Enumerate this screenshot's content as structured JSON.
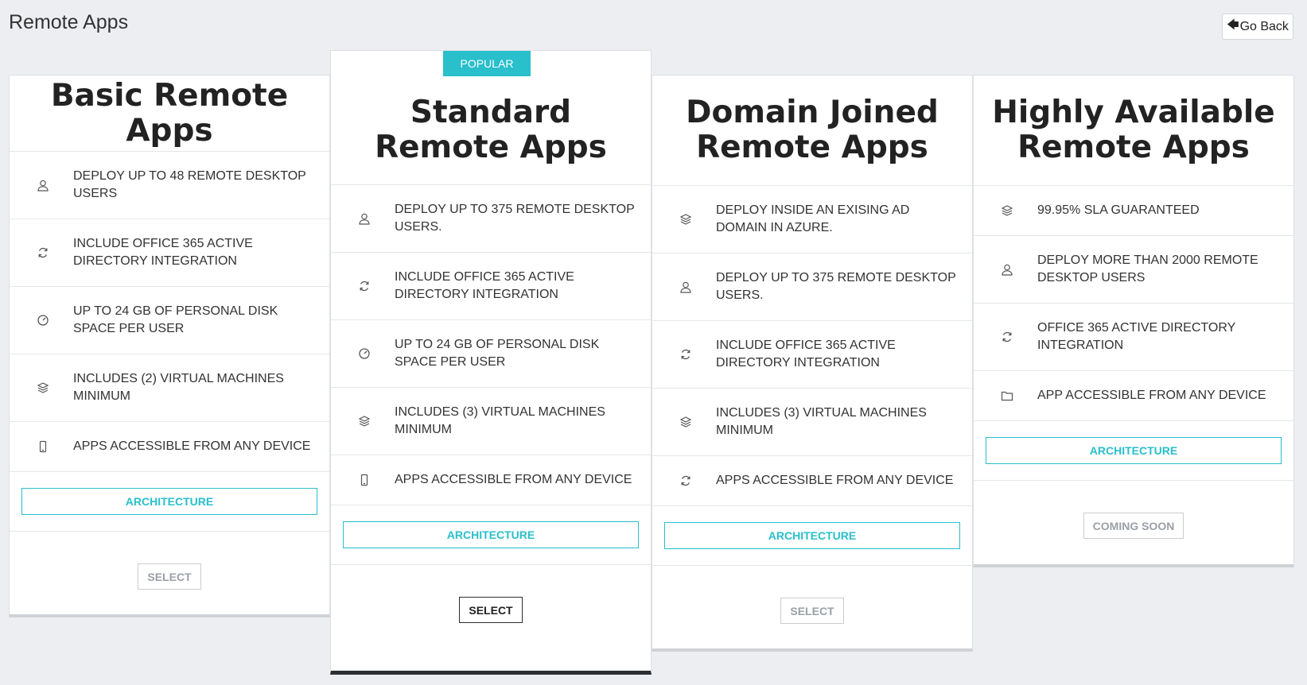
{
  "page": {
    "title": "Remote Apps",
    "go_back_label": "Go Back",
    "go_back_icon": "arrow-left-icon"
  },
  "colors": {
    "accent": "#29bfcb",
    "background": "#eceef2",
    "popular_badge": "#29bfcb",
    "standard_bottom_border": "#2b2f33"
  },
  "cards": [
    {
      "title": "Basic Remote Apps",
      "features": [
        {
          "icon": "user-icon",
          "text": "DEPLOY UP TO 48 REMOTE DESKTOP USERS"
        },
        {
          "icon": "sync-icon",
          "text": "INCLUDE OFFICE 365 ACTIVE DIRECTORY INTEGRATION"
        },
        {
          "icon": "gauge-icon",
          "text": "UP TO 24 GB OF PERSONAL DISK SPACE PER USER"
        },
        {
          "icon": "layers-icon",
          "text": "INCLUDES (2) VIRTUAL MACHINES MINIMUM"
        },
        {
          "icon": "mobile-icon",
          "text": "APPS ACCESSIBLE FROM ANY DEVICE"
        }
      ],
      "architecture_label": "ARCHITECTURE",
      "action_label": "SELECT"
    },
    {
      "badge": "POPULAR",
      "title": "Standard Remote Apps",
      "features": [
        {
          "icon": "user-icon",
          "text": "DEPLOY UP TO 375 REMOTE DESKTOP USERS."
        },
        {
          "icon": "sync-icon",
          "text": "INCLUDE OFFICE 365 ACTIVE DIRECTORY INTEGRATION"
        },
        {
          "icon": "gauge-icon",
          "text": "UP TO 24 GB OF PERSONAL DISK SPACE PER USER"
        },
        {
          "icon": "layers-icon",
          "text": "INCLUDES (3) VIRTUAL MACHINES MINIMUM"
        },
        {
          "icon": "mobile-icon",
          "text": "APPS ACCESSIBLE FROM ANY DEVICE"
        }
      ],
      "architecture_label": "ARCHITECTURE",
      "action_label": "SELECT"
    },
    {
      "title": "Domain Joined Remote Apps",
      "features": [
        {
          "icon": "layers-icon",
          "text": "DEPLOY INSIDE AN EXISING AD DOMAIN IN AZURE."
        },
        {
          "icon": "user-icon",
          "text": "DEPLOY UP TO 375 REMOTE DESKTOP USERS."
        },
        {
          "icon": "sync-icon",
          "text": "INCLUDE OFFICE 365 ACTIVE DIRECTORY INTEGRATION"
        },
        {
          "icon": "layers-icon",
          "text": "INCLUDES (3) VIRTUAL MACHINES MINIMUM"
        },
        {
          "icon": "sync-icon",
          "text": "APPS ACCESSIBLE FROM ANY DEVICE"
        }
      ],
      "architecture_label": "ARCHITECTURE",
      "action_label": "SELECT"
    },
    {
      "title": "Highly Available Remote Apps",
      "features": [
        {
          "icon": "layers-icon",
          "text": "99.95% SLA GUARANTEED"
        },
        {
          "icon": "user-icon",
          "text": "DEPLOY MORE THAN 2000 REMOTE DESKTOP USERS"
        },
        {
          "icon": "sync-icon",
          "text": "OFFICE 365 ACTIVE DIRECTORY INTEGRATION"
        },
        {
          "icon": "folder-icon",
          "text": "APP ACCESSIBLE FROM ANY DEVICE"
        }
      ],
      "architecture_label": "ARCHITECTURE",
      "action_label": "COMING SOON"
    }
  ]
}
